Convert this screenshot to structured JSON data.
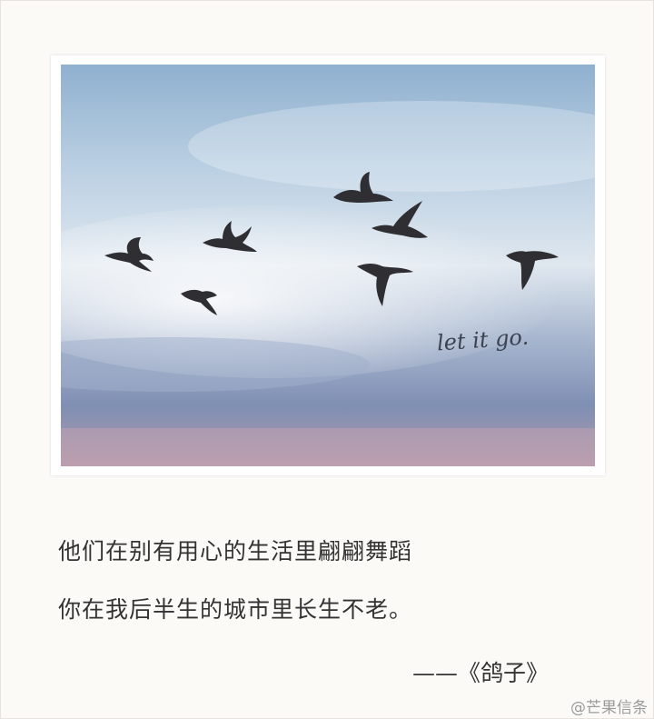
{
  "photo": {
    "handwriting": "let it go.",
    "birds": 7
  },
  "poem": {
    "line1": "他们在别有用心的生活里翩翩舞蹈",
    "line2": "你在我后半生的城市里长生不老。",
    "attribution": "——《鸽子》"
  },
  "watermark": "@芒果信条"
}
